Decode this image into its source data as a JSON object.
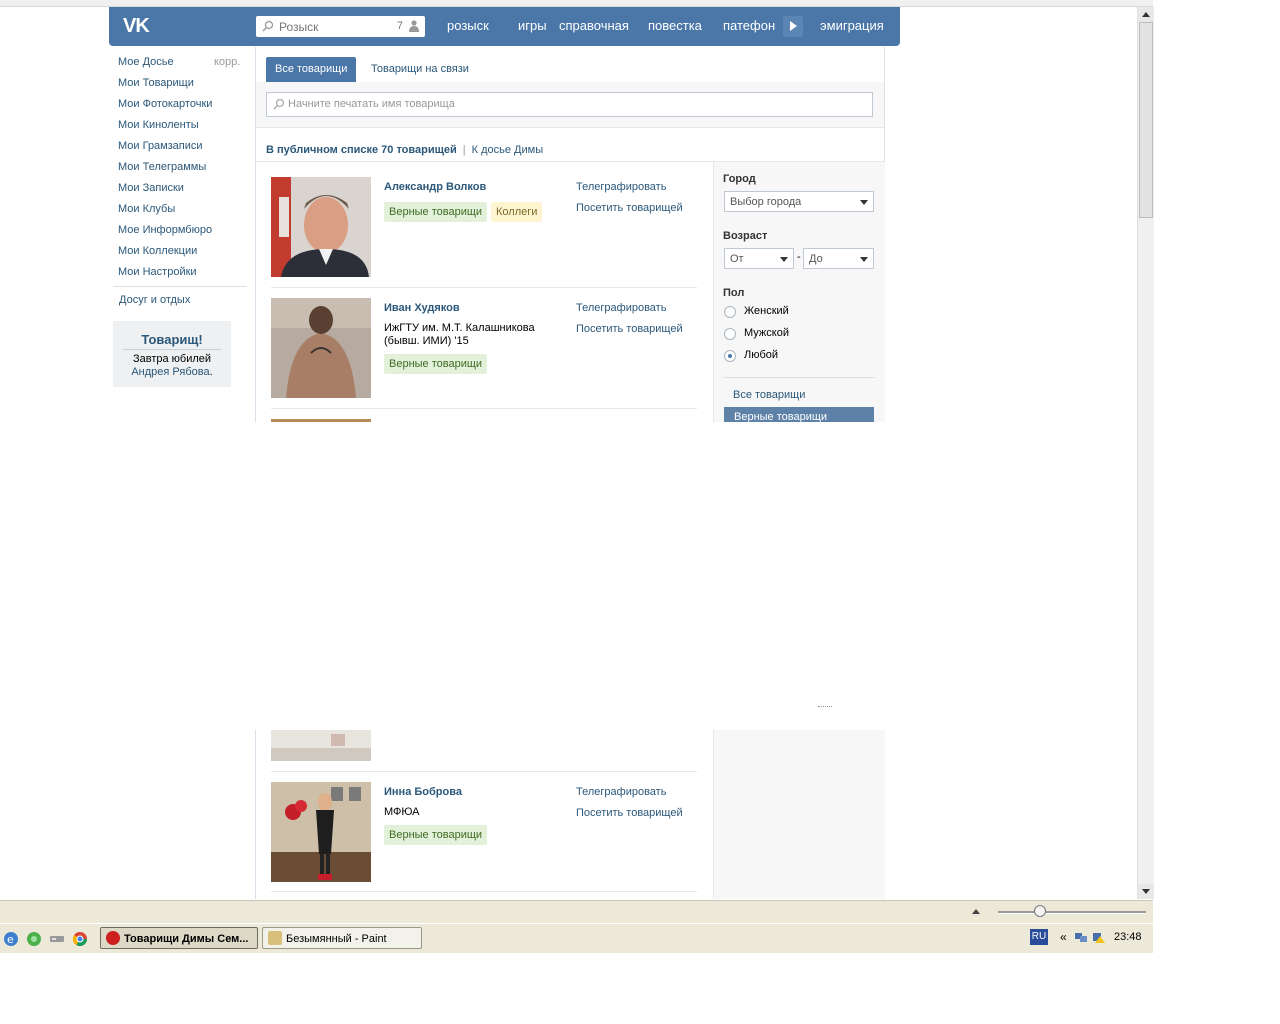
{
  "header": {
    "logo": "VK",
    "search_placeholder": "Розыск",
    "search_count": "7",
    "nav": [
      "розыск",
      "игры",
      "справочная",
      "повестка",
      "патефон",
      "эмиграция"
    ]
  },
  "left_menu": {
    "items": [
      "Мое Досье",
      "Мои Товарищи",
      "Мои Фотокарточки",
      "Мои Киноленты",
      "Мои Грамзаписи",
      "Мои Телеграммы",
      "Мои Записки",
      "Мои Клубы",
      "Мое Информбюро",
      "Мои Коллекции",
      "Мои Настройки"
    ],
    "edit_label": "корр.",
    "extra": "Досуг и отдых"
  },
  "reminder": {
    "title": "Товарищ!",
    "text_prefix": "Завтра юбилей ",
    "text_link": "Андрея Рябова",
    "text_suffix": "."
  },
  "tabs": {
    "active": "Все товарищи",
    "other": "Товарищи на связи"
  },
  "filter": {
    "placeholder": "Начните печатать имя товарища"
  },
  "summary": {
    "count_text": "В публичном списке 70 товарищей",
    "link": "К досье Димы"
  },
  "friends": [
    {
      "name": "Александр Волков",
      "edu": "",
      "tags": [
        "Верные товарищи",
        "Коллеги"
      ],
      "actions": [
        "Телеграфировать",
        "Посетить товарищей"
      ]
    },
    {
      "name": "Иван Худяков",
      "edu": "ИжГТУ им. М.Т. Калашникова (бывш. ИМИ) '15",
      "tags": [
        "Верные товарищи"
      ],
      "actions": [
        "Телеграфировать",
        "Посетить товарищей"
      ]
    },
    {
      "name": "Инна Боброва",
      "edu": "МФЮА",
      "tags": [
        "Верные товарищи"
      ],
      "actions": [
        "Телеграфировать",
        "Посетить товарищей"
      ]
    }
  ],
  "sidebar_filters": {
    "city_label": "Город",
    "city_select": "Выбор города",
    "age_label": "Возраст",
    "age_from": "От",
    "age_to": "До",
    "age_dash": "-",
    "sex_label": "Пол",
    "sex_options": [
      "Женский",
      "Мужской",
      "Любой"
    ],
    "sex_selected": "Любой",
    "list_all": "Все товарищи",
    "list_selected": "Верные товарищи"
  },
  "taskbar": {
    "tasks": [
      "Товарищи Димы Сем...",
      "Безымянный - Paint"
    ],
    "lang": "RU",
    "chevron": "«",
    "time": "23:48"
  }
}
